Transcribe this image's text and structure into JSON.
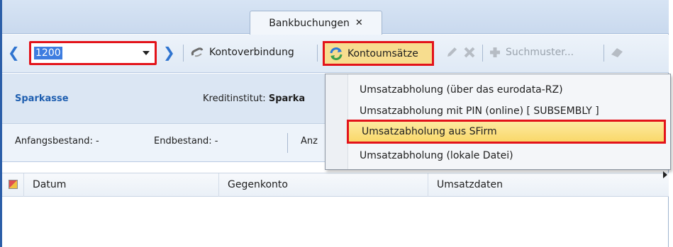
{
  "tab": {
    "title": "Bankbuchungen",
    "close": "✕"
  },
  "toolbar": {
    "account_value": "1200",
    "kontoverbindung": "Kontoverbindung",
    "kontoumsaetze": "Kontoumsätze",
    "suchmuster": "Suchmuster..."
  },
  "info": {
    "bank_name": "Sparkasse",
    "kreditinstitut_label": "Kreditinstitut:",
    "kreditinstitut_value": "Sparka"
  },
  "bestand": {
    "anfang": "Anfangsbestand: -",
    "end": "Endbestand: -",
    "anz": "Anz"
  },
  "grid": {
    "columns": [
      "Datum",
      "Gegenkonto",
      "Umsatzdaten"
    ]
  },
  "menu": {
    "items": [
      {
        "label": "Umsatzabholung (über das eurodata-RZ)"
      },
      {
        "label": "Umsatzabholung mit PIN (online) [ SUBSEMBLY ]"
      },
      {
        "label": "Umsatzabholung aus SFirm"
      },
      {
        "label": "Umsatzabholung (lokale Datei)"
      }
    ]
  },
  "colors": {
    "highlight_border": "#e3131a",
    "accent": "#2f74d0"
  }
}
